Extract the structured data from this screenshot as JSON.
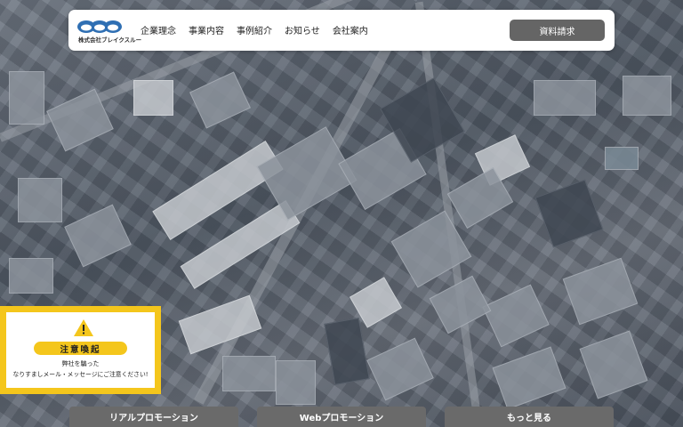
{
  "header": {
    "logo_text": "株式会社ブレイクスルー",
    "nav": [
      "企業理念",
      "事業内容",
      "事例紹介",
      "お知らせ",
      "会社案内"
    ],
    "cta_label": "資料請求"
  },
  "warning": {
    "title": "注意喚起",
    "line1": "弊社を騙った",
    "line2": "なりすましメール・メッセージにご注意ください!"
  },
  "tabs": [
    "リアルプロモーション",
    "Webプロモーション",
    "もっと見る"
  ],
  "colors": {
    "accent": "#f4c61c",
    "button": "#656565",
    "tab": "#6a6a6a",
    "logo_blue": "#2f6fb3"
  },
  "icons": {
    "warning": "warning-triangle-icon",
    "logo": "logo-mark-icon"
  }
}
